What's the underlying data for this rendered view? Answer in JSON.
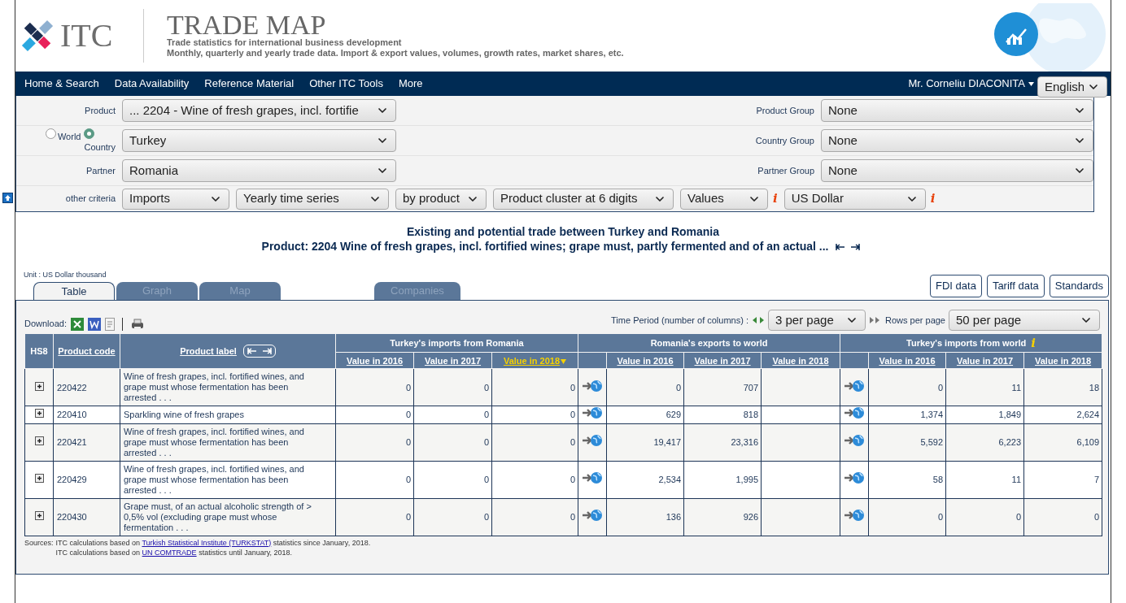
{
  "header": {
    "logo_text": "ITC",
    "title": "TRADE MAP",
    "subtitle": "Trade statistics for international business development",
    "tagline": "Monthly, quarterly and yearly trade data. Import & export values, volumes, growth rates, market shares, etc."
  },
  "nav": {
    "items": [
      "Home & Search",
      "Data Availability",
      "Reference Material",
      "Other ITC Tools",
      "More"
    ],
    "user": "Mr. Corneliu DIACONITA",
    "language": "English"
  },
  "filters": [
    {
      "label": "Product",
      "value": "... 2204 - Wine of fresh grapes, incl. fortifie",
      "group_label": "Product Group",
      "group_value": "None"
    },
    {
      "radios": [
        {
          "label": "World",
          "selected": false
        },
        {
          "label": "Country",
          "selected": true
        }
      ],
      "value": "Turkey",
      "group_label": "Country Group",
      "group_value": "None"
    },
    {
      "label": "Partner",
      "value": "Romania",
      "group_label": "Partner Group",
      "group_value": "None"
    }
  ],
  "other_criteria": {
    "label": "other criteria",
    "selects": [
      {
        "value": "Imports"
      },
      {
        "value": "Yearly time series"
      },
      {
        "value": "by product"
      },
      {
        "value": "Product cluster at 6 digits"
      },
      {
        "value": "Values",
        "info_icon": "i"
      },
      {
        "value": "US Dollar",
        "info_icon": "i"
      }
    ]
  },
  "report_title": "Existing and potential trade between Turkey and Romania",
  "report_product": "Product: 2204 Wine of fresh grapes, incl. fortified wines; grape must, partly fermented and of an actual ...",
  "unit": "Unit : US Dollar thousand",
  "tabs": [
    {
      "label": "Table",
      "selected": true
    },
    {
      "label": "Graph",
      "selected": false
    },
    {
      "label": "Map",
      "selected": false
    },
    {
      "label": "Companies",
      "selected": false
    }
  ],
  "buttons": [
    "FDI data",
    "Tariff data",
    "Standards"
  ],
  "toolbar": {
    "download_label": "Download:",
    "time_period_label": "Time Period (number of columns) :",
    "time_period_value": "3 per page",
    "rows_label": "Rows per page",
    "rows_value": "50 per page"
  },
  "table": {
    "hs8": "HS8",
    "code_header": "Product code",
    "label_header": "Product label",
    "groups": [
      {
        "title": "Turkey's imports from Romania",
        "link": false,
        "columns": [
          {
            "label": "Value in 2016",
            "sorted": false
          },
          {
            "label": "Value in 2017",
            "sorted": false
          },
          {
            "label": "Value in 2018",
            "sorted": true
          }
        ]
      },
      {
        "title": "Romania's exports to world",
        "link": true,
        "columns": [
          {
            "label": "Value in 2016",
            "sorted": false
          },
          {
            "label": "Value in 2017",
            "sorted": false
          },
          {
            "label": "Value in 2018",
            "sorted": false
          }
        ]
      },
      {
        "title": "Turkey's imports from world",
        "info_icon": "i",
        "link": true,
        "columns": [
          {
            "label": "Value in 2016",
            "sorted": false
          },
          {
            "label": "Value in 2017",
            "sorted": false
          },
          {
            "label": "Value in 2018",
            "sorted": false
          }
        ]
      }
    ],
    "rows": [
      {
        "code": "220422",
        "label": "Wine of fresh grapes, incl. fortified wines, and grape must whose fermentation has been arrested . . .",
        "values": [
          {
            "value_2016": "0",
            "value_2017": "0",
            "value_2018": "0"
          },
          {
            "value_2016": "0",
            "value_2017": "707"
          },
          {
            "value_2016": "0",
            "value_2017": "11",
            "value_2018": "18"
          }
        ]
      },
      {
        "code": "220410",
        "label": "Sparkling wine of fresh grapes",
        "values": [
          {
            "value_2016": "0",
            "value_2017": "0",
            "value_2018": "0"
          },
          {
            "value_2016": "629",
            "value_2017": "818"
          },
          {
            "value_2016": "1,374",
            "value_2017": "1,849",
            "value_2018": "2,624"
          }
        ]
      },
      {
        "code": "220421",
        "label": "Wine of fresh grapes, incl. fortified wines, and grape must whose fermentation has been arrested . . .",
        "values": [
          {
            "value_2016": "0",
            "value_2017": "0",
            "value_2018": "0"
          },
          {
            "value_2016": "19,417",
            "value_2017": "23,316"
          },
          {
            "value_2016": "5,592",
            "value_2017": "6,223",
            "value_2018": "6,109"
          }
        ]
      },
      {
        "code": "220429",
        "label": "Wine of fresh grapes, incl. fortified wines, and grape must whose fermentation has been arrested . . .",
        "values": [
          {
            "value_2016": "0",
            "value_2017": "0",
            "value_2018": "0"
          },
          {
            "value_2016": "2,534",
            "value_2017": "1,995"
          },
          {
            "value_2016": "58",
            "value_2017": "11",
            "value_2018": "7"
          }
        ]
      },
      {
        "code": "220430",
        "label": "Grape must, of an actual alcoholic strength of > 0,5% vol (excluding grape must whose fermentation . . .",
        "values": [
          {
            "value_2016": "0",
            "value_2017": "0",
            "value_2018": "0"
          },
          {
            "value_2016": "136",
            "value_2017": "926"
          },
          {
            "value_2016": "0",
            "value_2017": "0",
            "value_2018": "0"
          }
        ]
      }
    ]
  },
  "sources": {
    "prefix": "Sources:",
    "lines": [
      {
        "before": "ITC calculations based on",
        "link": "Turkish Statistical Institute (TURKSTAT)",
        "after": "statistics since January, 2018."
      },
      {
        "before": "ITC calculations based on",
        "link": "UN COMTRADE",
        "after": "statistics until January, 2018."
      }
    ]
  }
}
